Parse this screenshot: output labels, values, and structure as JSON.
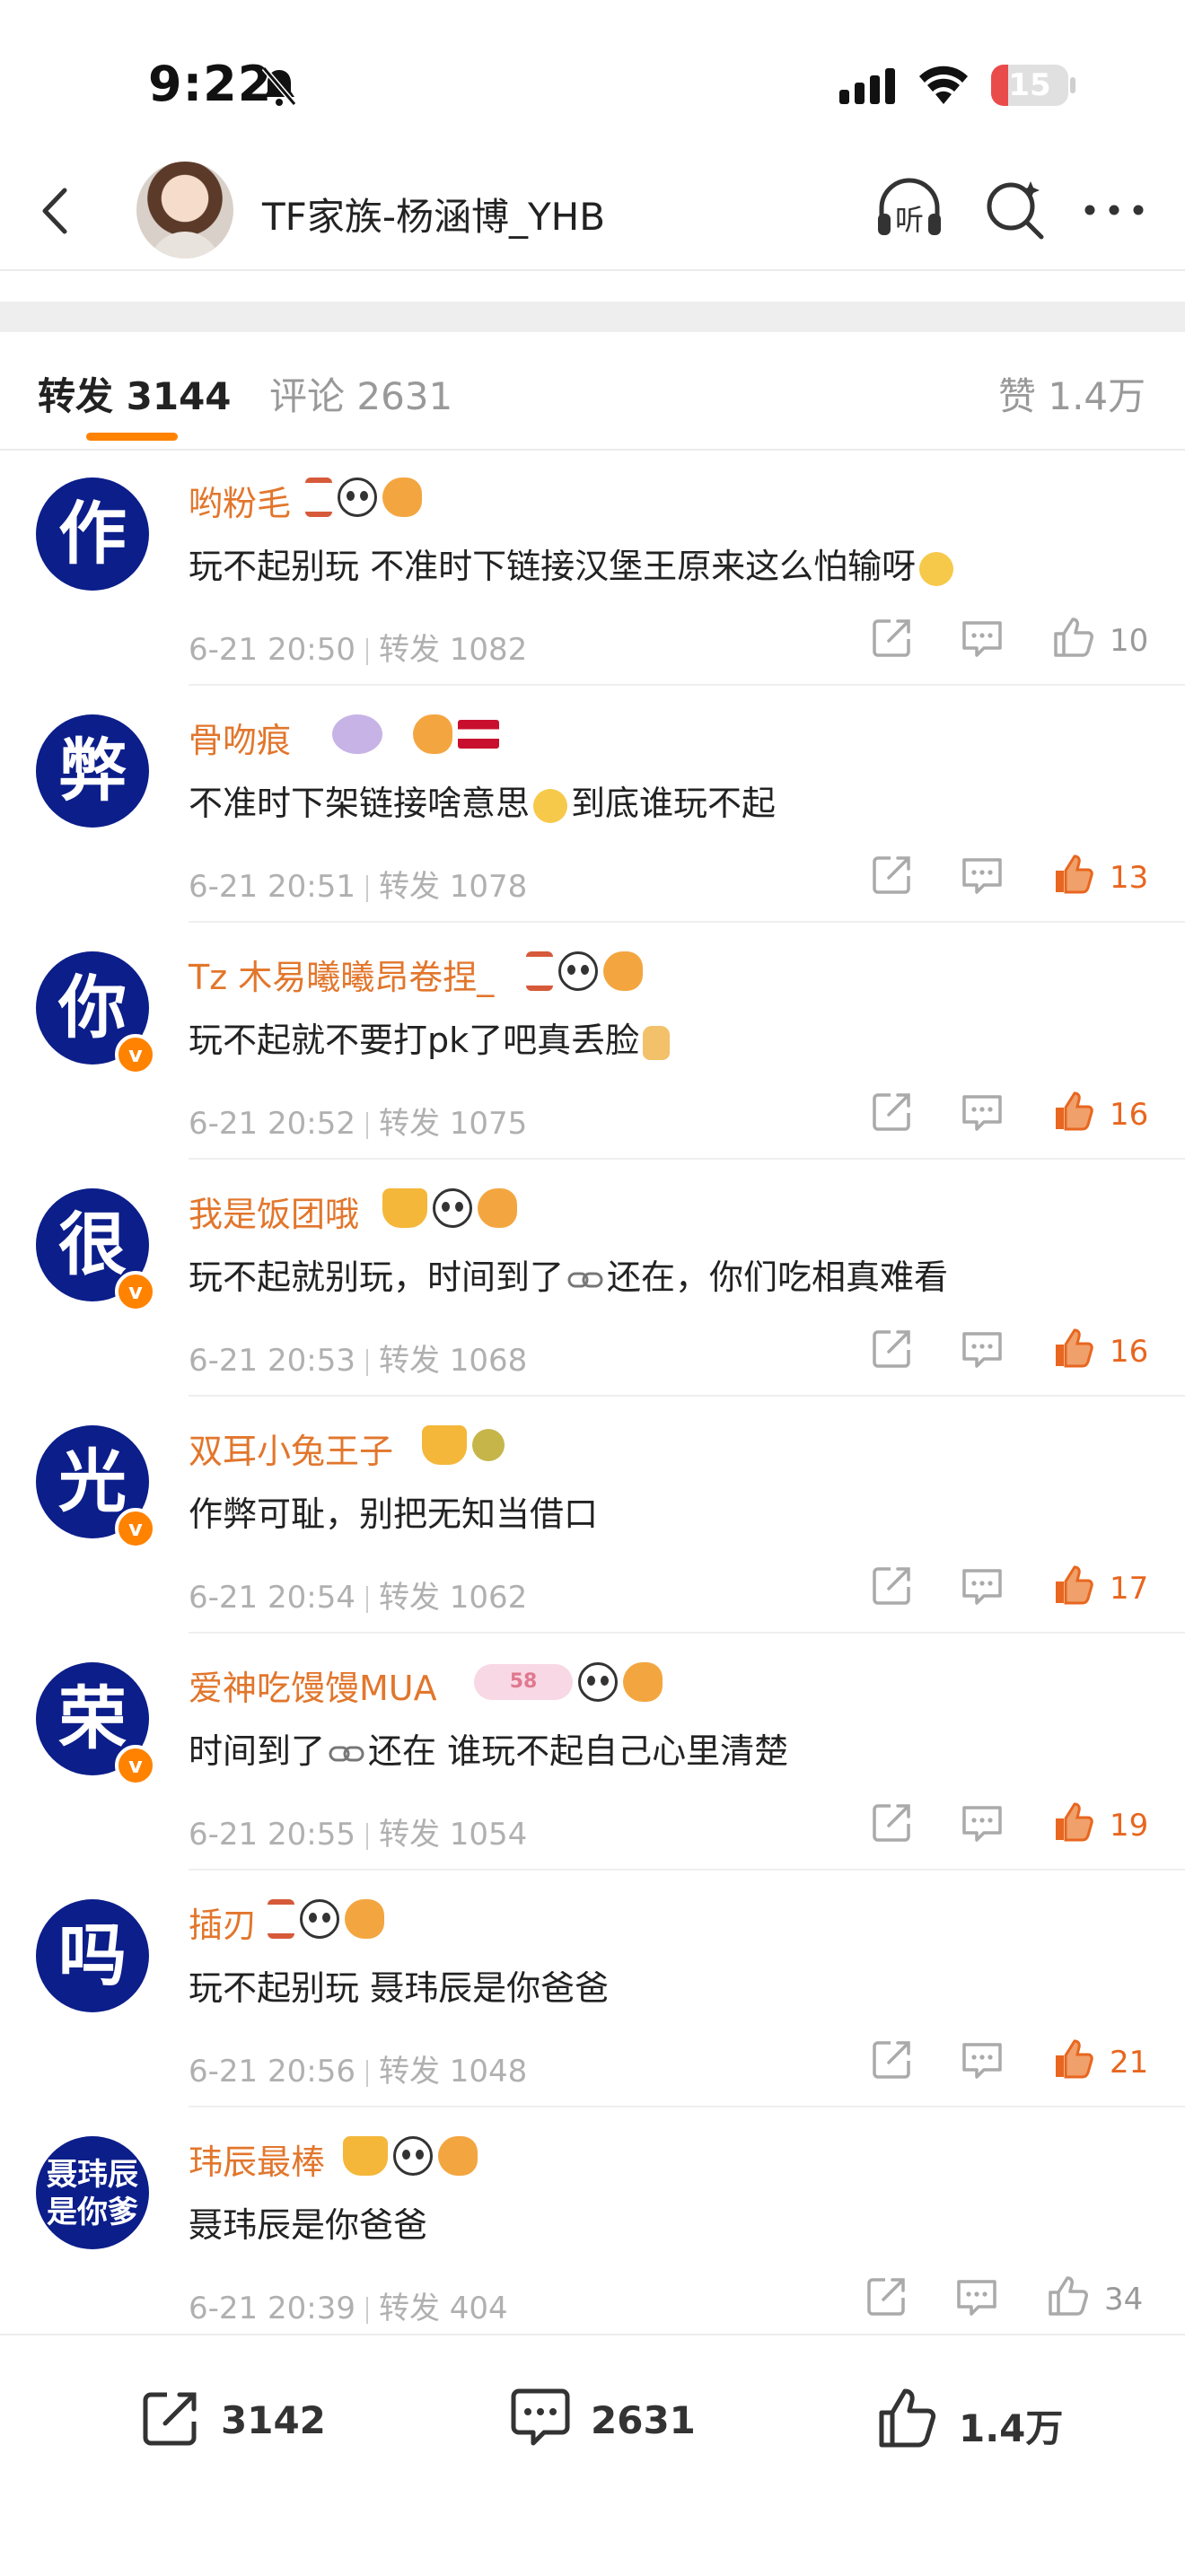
{
  "status": {
    "time": "9:22",
    "battery": "15"
  },
  "header": {
    "title": "TF家族-杨涵博_YHB",
    "listen_label": "听"
  },
  "tabs": {
    "repost": "转发 3144",
    "comment": "评论 2631",
    "like": "赞 1.4万"
  },
  "comments": [
    {
      "avatar_char": "作",
      "verified": false,
      "name": "哟粉毛",
      "text": "玩不起别玩 不准时下链接汉堡王原来这么怕输呀",
      "time": "6-21 20:50",
      "repost": "转发 1082",
      "likes": "10",
      "liked": false
    },
    {
      "avatar_char": "弊",
      "verified": false,
      "name": "骨吻痕",
      "text": "不准时下架链接啥意思",
      "text2": "到底谁玩不起",
      "time": "6-21 20:51",
      "repost": "转发 1078",
      "likes": "13",
      "liked": true
    },
    {
      "avatar_char": "你",
      "verified": true,
      "name": "Tz 木易曦曦昂卷捏_",
      "text": "玩不起就不要打pk了吧真丢脸",
      "time": "6-21 20:52",
      "repost": "转发 1075",
      "likes": "16",
      "liked": true
    },
    {
      "avatar_char": "很",
      "verified": true,
      "name": "我是饭团哦",
      "text": "玩不起就别玩，时间到了",
      "text2": "还在，你们吃相真难看",
      "time": "6-21 20:53",
      "repost": "转发 1068",
      "likes": "16",
      "liked": true
    },
    {
      "avatar_char": "光",
      "verified": true,
      "name": "双耳小兔王子",
      "text": "作弊可耻，别把无知当借口",
      "time": "6-21 20:54",
      "repost": "转发 1062",
      "likes": "17",
      "liked": true
    },
    {
      "avatar_char": "荣",
      "verified": true,
      "name": "爱神吃馒馒MUA",
      "badge_text": "58",
      "text": "时间到了",
      "text2": "还在 谁玩不起自己心里清楚",
      "time": "6-21 20:55",
      "repost": "转发 1054",
      "likes": "19",
      "liked": true
    },
    {
      "avatar_char": "吗",
      "verified": false,
      "name": "插刃",
      "text": "玩不起别玩 聂玮辰是你爸爸",
      "time": "6-21 20:56",
      "repost": "转发 1048",
      "likes": "21",
      "liked": true
    },
    {
      "avatar_char": "聂玮辰是你爹",
      "avatar_line1": "聂玮辰",
      "avatar_line2": "是你爹",
      "verified": false,
      "name": "玮辰最棒",
      "text": "聂玮辰是你爸爸",
      "time": "6-21 20:39",
      "repost": "转发 404",
      "likes": "34",
      "liked": false
    }
  ],
  "bottom_bar": {
    "repost": "3142",
    "comment": "2631",
    "like": "1.4万"
  },
  "colors": {
    "accent": "#ff8200",
    "name": "#e2762c",
    "liked": "#e8661f",
    "avatar_bg": "#0c1e8a"
  },
  "icons": [
    "back-icon",
    "headphones-icon",
    "search-icon",
    "more-icon",
    "share-icon",
    "comment-icon",
    "like-icon"
  ]
}
